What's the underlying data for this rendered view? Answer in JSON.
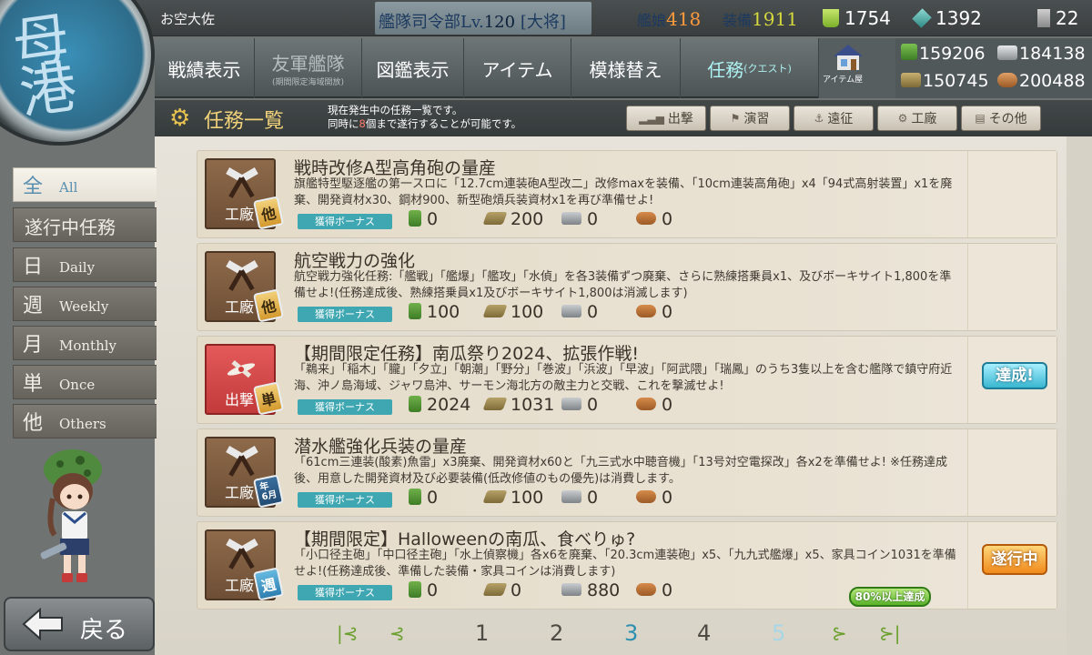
{
  "header": {
    "admiral_name": "お空大佐",
    "hq_label": "艦隊司令部Lv.",
    "hq_level": "120",
    "hq_rank": "[大将]",
    "kanmusu_label": "艦娘",
    "kanmusu_count": "418",
    "equip_label": "装備",
    "equip_count": "1911",
    "instant_repair": "1754",
    "dev_material": "1392",
    "improve_material": "22"
  },
  "nav": {
    "items": [
      {
        "label": "戦績表示"
      },
      {
        "label": "友軍艦隊",
        "sub": "(期間限定海域開放)"
      },
      {
        "label": "図鑑表示"
      },
      {
        "label": "アイテム"
      },
      {
        "label": "模様替え"
      },
      {
        "label": "任務",
        "small": "(クエスト)"
      }
    ],
    "shop_label": "アイテム屋"
  },
  "materials": {
    "fuel": "159206",
    "ammo": "150745",
    "steel": "184138",
    "bauxite": "200488"
  },
  "emblem_text": "母港",
  "page": {
    "title": "任務一覧",
    "note_line1": "現在発生中の任務一覧です。",
    "note_line2a": "同時に",
    "note_count": "8",
    "note_line2b": "個まで遂行することが可能です。"
  },
  "categories": [
    {
      "label": "出撃"
    },
    {
      "label": "演習"
    },
    {
      "label": "遠征"
    },
    {
      "label": "工廠"
    },
    {
      "label": "その他"
    }
  ],
  "filters": [
    {
      "kanji": "全",
      "english": "All"
    },
    {
      "kanji": "遂行中任務",
      "english": ""
    },
    {
      "kanji": "日",
      "english": "Daily"
    },
    {
      "kanji": "週",
      "english": "Weekly"
    },
    {
      "kanji": "月",
      "english": "Monthly"
    },
    {
      "kanji": "単",
      "english": "Once"
    },
    {
      "kanji": "他",
      "english": "Others"
    }
  ],
  "bonus_label": "獲得ボーナス",
  "quests": [
    {
      "category": "工廠",
      "freq": "他",
      "title": "戦時改修A型高角砲の量産",
      "desc": "旗艦特型駆逐艦の第一スロに「12.7cm連装砲A型改二」改修maxを装備、「10cm連装高角砲」x4「94式高射装置」x1を廃棄、開発資材x30、鋼材900、新型砲熕兵装資材x1を再び準備せよ!",
      "fuel": "0",
      "ammo": "200",
      "steel": "0",
      "baux": "0",
      "status": ""
    },
    {
      "category": "工廠",
      "freq": "他",
      "title": "航空戦力の強化",
      "desc": "航空戦力強化任務:「艦戦」「艦爆」「艦攻」「水偵」を各3装備ずつ廃棄、さらに熟練搭乗員x1、及びボーキサイト1,800を準備せよ!(任務達成後、熟練搭乗員x1及びボーキサイト1,800は消滅します)",
      "fuel": "100",
      "ammo": "100",
      "steel": "0",
      "baux": "0",
      "status": ""
    },
    {
      "category": "出撃",
      "freq": "単",
      "title": "【期間限定任務】南瓜祭り2024、拡張作戦!",
      "desc": "「鵜来」「稲木」「朧」「夕立」「朝潮」「野分」「巻波」「浜波」「早波」「阿武隈」「瑞鳳」のうち3隻以上を含む艦隊で鎮守府近海、沖ノ島海域、ジャワ島沖、サーモン海北方の敵主力と交戦、これを撃滅せよ!",
      "fuel": "2024",
      "ammo": "1031",
      "steel": "0",
      "baux": "0",
      "status": "達成!"
    },
    {
      "category": "工廠",
      "freq": "年\n6月",
      "title": "潜水艦強化兵装の量産",
      "desc": "「61cm三連装(酸素)魚雷」x3廃棄、開発資材x60と「九三式水中聴音機」「13号対空電探改」各x2を準備せよ! ※任務達成後、用意した開発資材及び必要装備(低改修値のもの優先)は消費します。",
      "fuel": "0",
      "ammo": "100",
      "steel": "0",
      "baux": "0",
      "status": ""
    },
    {
      "category": "工廠",
      "freq": "週",
      "title": "【期間限定】Halloweenの南瓜、食べりゅ?",
      "desc": "「小口径主砲」「中口径主砲」「水上偵察機」各x6を廃棄、「20.3cm連装砲」x5、「九九式艦爆」x5、家具コイン1031を準備せよ!(任務達成後、準備した装備・家具コインは消費します)",
      "fuel": "0",
      "ammo": "0",
      "steel": "880",
      "baux": "0",
      "status": "遂行中",
      "progress": "80%以上達成"
    }
  ],
  "pager": {
    "pages": [
      "1",
      "2",
      "3",
      "4",
      "5"
    ],
    "current": "3"
  },
  "back_label": "戻る"
}
